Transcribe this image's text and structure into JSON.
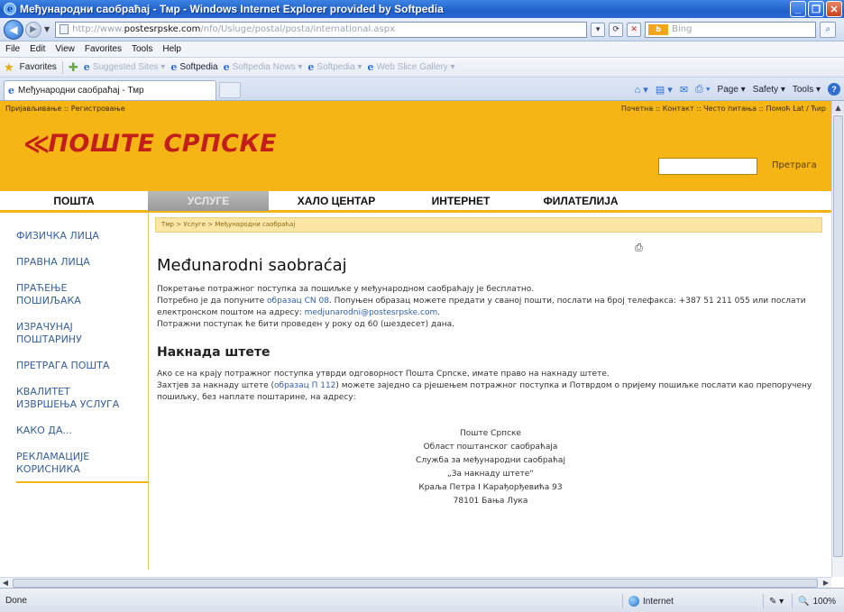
{
  "window": {
    "title": "Међународни саобраћај - Тмр - Windows Internet Explorer provided by Softpedia",
    "controls": {
      "min": "_",
      "max": "❐",
      "close": "✕"
    }
  },
  "address_bar": {
    "url_prefix": "http://www.",
    "url_host": "postesrpske.com",
    "url_path": "/nfo/Usluge/postal/posta/international.aspx",
    "search_placeholder": "Bing",
    "search_engine": "bing"
  },
  "menu": [
    "File",
    "Edit",
    "View",
    "Favorites",
    "Tools",
    "Help"
  ],
  "favorites_bar": {
    "label": "Favorites",
    "items": [
      {
        "label": "Suggested Sites ▾",
        "faded": true
      },
      {
        "label": "Softpedia",
        "faded": false
      },
      {
        "label": "Softpedia News ▾",
        "faded": true
      },
      {
        "label": "Softpedia ▾",
        "faded": true
      },
      {
        "label": "Web Slice Gallery ▾",
        "faded": true
      }
    ]
  },
  "tab": {
    "label": "Међународни саобраћај - Тмр"
  },
  "command_bar": {
    "page": "Page ▾",
    "safety": "Safety ▾",
    "tools": "Tools ▾",
    "help": "?"
  },
  "site": {
    "top_left_links": "Пријављивање :: Регистровање",
    "top_right_links": "Почетна :: Контакт :: Често питања :: Помоћ   Lat / Ћир",
    "logo_text": "ПОШТЕ СРПСКЕ",
    "search_button": "Претрага",
    "nav": [
      {
        "label": "ПОШТА",
        "width": 164,
        "active": false
      },
      {
        "label": "УСЛУГЕ",
        "width": 134,
        "active": true
      },
      {
        "label": "ХАЛО ЦЕНТАР",
        "width": 150,
        "active": false
      },
      {
        "label": "ИНТЕРНЕТ",
        "width": 126,
        "active": false
      },
      {
        "label": "ФИЛАТЕЛИЈА",
        "width": 140,
        "active": false
      }
    ],
    "sidebar": [
      "ФИЗИЧКА ЛИЦА",
      "ПРАВНА ЛИЦА",
      "ПРАЋЕЊЕ ПОШИЉАКА",
      "ИЗРАЧУНАЈ ПОШТАРИНУ",
      "ПРЕТРАГА ПОШТА",
      "КВАЛИТЕТ ИЗВРШЕЊА УСЛУГА",
      "КАКО ДА...",
      "РЕКЛАМАЦИЈЕ КОРИСНИКА"
    ],
    "breadcrumb": "Тмр > Услуге > Међународни саобраћај",
    "content": {
      "title": "Međunarodni saobraćaj",
      "p1": "Покретање потражног поступка за пошиљке у међународном саобраћају је бесплатно.",
      "p2_a": "Потребно је да попуните ",
      "p2_link": "образац CN 08",
      "p2_b": ". Попуњен образац можете предати у сваној пошти, послати на број телефакса: +387 51 211 055 или послати електронском поштом на адресу: ",
      "p2_email": "medjunarodni@postesrpske.com",
      "p2_c": ".",
      "p3": "Потражни поступак ће бити проведен у року од 60 (шездесет) дана.",
      "h2": "Накнада штете",
      "p4": "Ако се на крају потражног поступка утврди одговорност Пошта Српске, имате право на накнаду штете.",
      "p5_a": "Захтјев за накнаду штете (",
      "p5_link": "образац П 112",
      "p5_b": ") можете заједно са рјешењем потражног поступка и Потврдом о пријему пошиљке послати као препоручену пошиљку, без наплате поштарине, на адресу:",
      "address": [
        "Поште Српске",
        "Област поштанског саобраћаја",
        "Служба за међународни саобраћај",
        "„За накнаду штете“",
        "Краља Петра I Карађорђевића 93",
        "78101 Бања Лука"
      ]
    }
  },
  "status_bar": {
    "left": "Done",
    "zone": "Internet",
    "zoom": "100%"
  }
}
